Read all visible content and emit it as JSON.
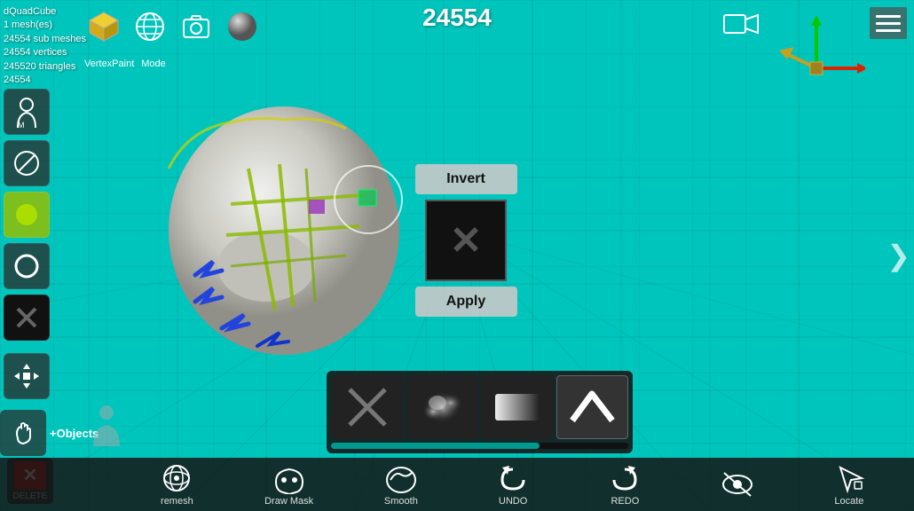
{
  "app": {
    "title": "dQuadCube",
    "mesh_count": "1 mesh(es)",
    "sub_meshes": "24554 sub meshes",
    "vertices": "24554 vertices",
    "triangles": "245520 triangles",
    "id": "24554",
    "vertex_label": "VertexPaint",
    "mode_label": "Mode"
  },
  "counter": {
    "value": "24554"
  },
  "popup": {
    "invert_label": "Invert",
    "apply_label": "Apply"
  },
  "brushes": {
    "items": [
      {
        "type": "x",
        "label": "x-brush"
      },
      {
        "type": "cloud",
        "label": "cloud-brush"
      },
      {
        "type": "gradient",
        "label": "gradient-brush"
      },
      {
        "type": "chevron",
        "label": "chevron-brush"
      }
    ]
  },
  "bottom_bar": {
    "buttons": [
      {
        "label": "remesh",
        "sublabel": ""
      },
      {
        "label": "Draw Mask",
        "sublabel": ""
      },
      {
        "label": "Smooth",
        "sublabel": ""
      },
      {
        "label": "UNDO",
        "sublabel": "UNDO"
      },
      {
        "label": "REDO",
        "sublabel": "REDO"
      },
      {
        "label": "Locate",
        "sublabel": ""
      }
    ]
  },
  "sidebar": {
    "buttons": [
      {
        "label": "person-icon"
      },
      {
        "label": "slash-icon"
      },
      {
        "label": "circle-icon"
      },
      {
        "label": "ring-icon"
      },
      {
        "label": "x-icon"
      }
    ]
  },
  "objects_label": "+Objects",
  "delete_label": "DELETE"
}
